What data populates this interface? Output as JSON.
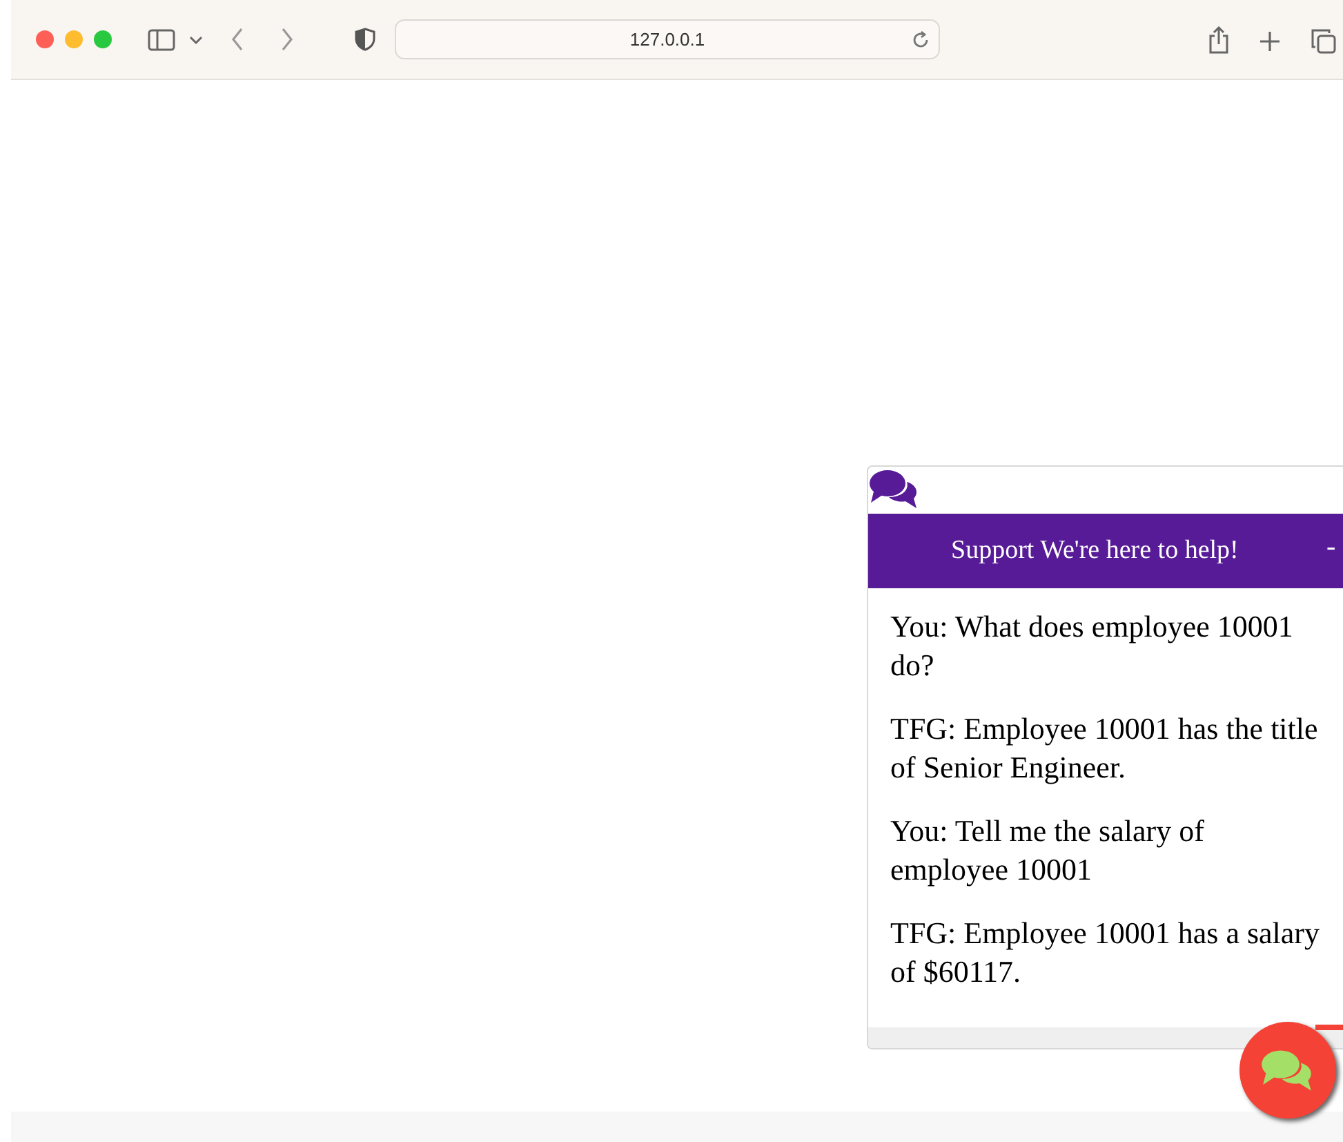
{
  "browser": {
    "url": "127.0.0.1"
  },
  "chat": {
    "title": "Support We're here to help!",
    "minimize": "-",
    "messages": [
      {
        "text": "You: What does employee 10001 do?"
      },
      {
        "text": "TFG: Employee 10001 has the title of Senior Engineer."
      },
      {
        "text": "You: Tell me the salary of employee 10001"
      },
      {
        "text": "TFG: Employee 10001 has a salary of $60117."
      }
    ]
  }
}
